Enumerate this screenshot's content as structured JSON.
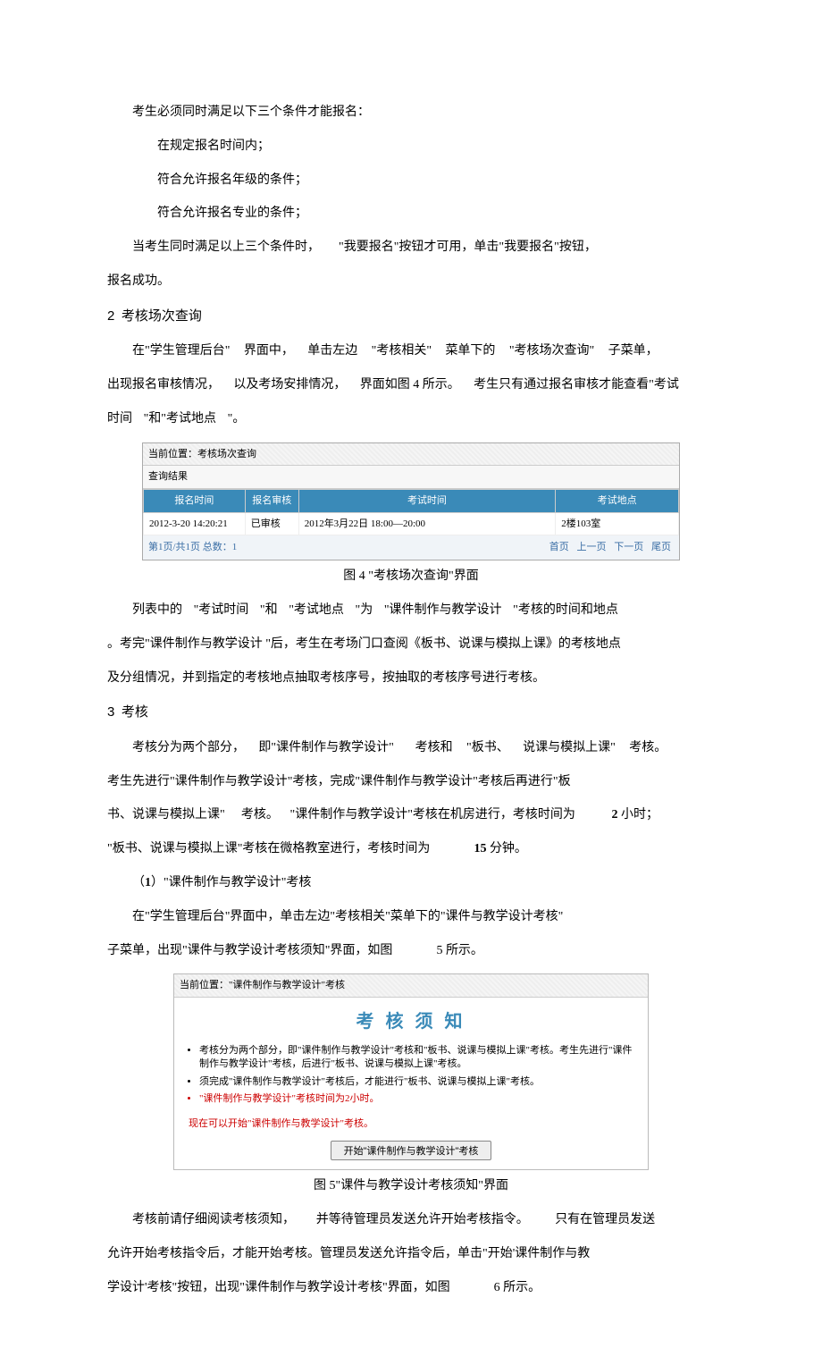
{
  "intro": {
    "line1": "考生必须同时满足以下三个条件才能报名：",
    "cond1": "在规定报名时间内；",
    "cond2": "符合允许报名年级的条件；",
    "cond3": "符合允许报名专业的条件；",
    "line2a": "当考生同时满足以上三个条件时，",
    "line2b": "\"我要报名\"按钮才可用，单击\"我要报名\"按钮，",
    "line2c": "报名成功。"
  },
  "sec2": {
    "num": "2",
    "title": "考核场次查询",
    "p1a": "在\"学生管理后台\"",
    "p1b": "界面中，",
    "p1c": "单击左边",
    "p1d": "\"考核相关\"",
    "p1e": "菜单下的",
    "p1f": "\"考核场次查询\"",
    "p1g": "子菜单，",
    "p2a": "出现报名审核情况，",
    "p2b": "以及考场安排情况，",
    "p2c": "界面如图 4 所示。",
    "p2d": "考生只有通过报名审核才能查看\"考试",
    "p2e": "时间",
    "p2f": "\"和\"考试地点",
    "p2g": "\"。"
  },
  "fig4": {
    "header": "当前位置：考核场次查询",
    "sub": "查询结果",
    "cols": {
      "c1": "报名时间",
      "c2": "报名审核",
      "c3": "考试时间",
      "c4": "考试地点"
    },
    "row": {
      "c1": "2012-3-20 14:20:21",
      "c2": "已审核",
      "c3": "2012年3月22日 18:00—20:00",
      "c4": "2楼103室"
    },
    "pagerL": "第1页/共1页 总数：1",
    "pg1": "首页",
    "pg2": "上一页",
    "pg3": "下一页",
    "pg4": "尾页",
    "caption": "图 4  \"考核场次查询\"界面"
  },
  "sec2b": {
    "p1a": "列表中的",
    "p1b": "\"考试时间",
    "p1c": "\"和",
    "p1d": "\"考试地点",
    "p1e": "\"为",
    "p1f": "\"课件制作与教学设计",
    "p1g": "\"考核的时间和地点",
    "p2": "。考完\"课件制作与教学设计 \"后，考生在考场门口查阅《板书、说课与模拟上课》的考核地点",
    "p3": "及分组情况，并到指定的考核地点抽取考核序号，按抽取的考核序号进行考核。"
  },
  "sec3": {
    "num": "3",
    "title": "考核",
    "p1a": "考核分为两个部分，",
    "p1b": "即\"课件制作与教学设计\"",
    "p1c": "考核和",
    "p1d": "\"板书、",
    "p1e": "说课与模拟上课\"",
    "p1f": "考核。",
    "p2": "考生先进行\"课件制作与教学设计\"考核，完成\"课件制作与教学设计\"考核后再进行\"板",
    "p3a": "书、说课与模拟上课\"",
    "p3b": "考核。",
    "p3c": "\"课件制作与教学设计\"考核在机房进行，考核时间为",
    "p3d": "2",
    "p3e": "小时；",
    "p4a": "\"板书、说课与模拟上课\"考核在微格教室进行，考核时间为",
    "p4b": "15",
    "p4c": "分钟。",
    "sub1": "（1）\"课件制作与教学设计\"考核",
    "p5": "在\"学生管理后台\"界面中，单击左边\"考核相关\"菜单下的\"课件与教学设计考核\"",
    "p6a": "子菜单，出现\"课件与教学设计考核须知\"界面，如图",
    "p6b": "5 所示。"
  },
  "fig5": {
    "bar": "当前位置：\"课件制作与教学设计\"考核",
    "title": "考 核 须 知",
    "li1": "考核分为两个部分，即\"课件制作与教学设计\"考核和\"板书、说课与模拟上课\"考核。考生先进行\"课件制作与教学设计\"考核，后进行\"板书、说课与模拟上课\"考核。",
    "li2": "须完成\"课件制作与教学设计\"考核后，才能进行\"板书、说课与模拟上课\"考核。",
    "li3": "\"课件制作与教学设计\"考核时间为2小时。",
    "ready": "现在可以开始\"课件制作与教学设计\"考核。",
    "btn": "开始\"课件制作与教学设计\"考核",
    "caption": "图 5\"课件与教学设计考核须知\"界面"
  },
  "tail": {
    "p1a": "考核前请仔细阅读考核须知，",
    "p1b": "并等待管理员发送允许开始考核指令。",
    "p1c": "只有在管理员发送",
    "p2": "允许开始考核指令后，才能开始考核。管理员发送允许指令后，单击\"开始'课件制作与教",
    "p3a": "学设计'考核\"按钮，出现\"课件制作与教学设计考核\"界面，如图",
    "p3b": "6 所示。"
  }
}
